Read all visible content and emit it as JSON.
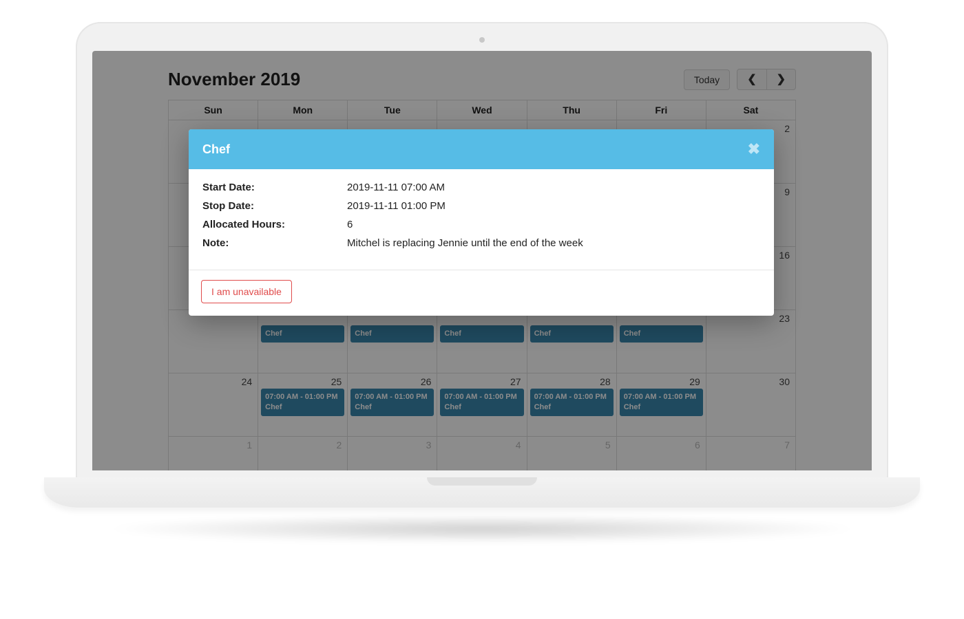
{
  "header": {
    "title": "November 2019",
    "today_label": "Today"
  },
  "days": [
    "Sun",
    "Mon",
    "Tue",
    "Wed",
    "Thu",
    "Fri",
    "Sat"
  ],
  "weeks": [
    [
      {
        "n": "",
        "other": true,
        "event": null
      },
      {
        "n": "",
        "other": true,
        "event": null
      },
      {
        "n": "",
        "other": true,
        "event": null
      },
      {
        "n": "",
        "other": true,
        "event": null
      },
      {
        "n": "",
        "other": true,
        "event": null
      },
      {
        "n": "",
        "other": true,
        "event": null
      },
      {
        "n": "2",
        "other": false,
        "event": null
      }
    ],
    [
      {
        "n": "",
        "other": false,
        "event": null
      },
      {
        "n": "",
        "other": false,
        "event": null
      },
      {
        "n": "",
        "other": false,
        "event": null
      },
      {
        "n": "",
        "other": false,
        "event": null
      },
      {
        "n": "",
        "other": false,
        "event": null
      },
      {
        "n": "",
        "other": false,
        "event": null
      },
      {
        "n": "9",
        "other": false,
        "event": null
      }
    ],
    [
      {
        "n": "",
        "other": false,
        "event": null
      },
      {
        "n": "",
        "other": false,
        "event": null
      },
      {
        "n": "",
        "other": false,
        "event": null
      },
      {
        "n": "",
        "other": false,
        "event": null
      },
      {
        "n": "",
        "other": false,
        "event": null
      },
      {
        "n": "",
        "other": false,
        "event": null
      },
      {
        "n": "16",
        "other": false,
        "event": null
      }
    ],
    [
      {
        "n": "",
        "other": false,
        "event": null
      },
      {
        "n": "",
        "other": false,
        "event": {
          "time": "",
          "role": "Chef"
        }
      },
      {
        "n": "",
        "other": false,
        "event": {
          "time": "",
          "role": "Chef"
        }
      },
      {
        "n": "",
        "other": false,
        "event": {
          "time": "",
          "role": "Chef"
        }
      },
      {
        "n": "",
        "other": false,
        "event": {
          "time": "",
          "role": "Chef"
        }
      },
      {
        "n": "",
        "other": false,
        "event": {
          "time": "",
          "role": "Chef"
        }
      },
      {
        "n": "23",
        "other": false,
        "event": null
      }
    ],
    [
      {
        "n": "24",
        "other": false,
        "event": null
      },
      {
        "n": "25",
        "other": false,
        "event": {
          "time": "07:00 AM - 01:00 PM",
          "role": "Chef"
        }
      },
      {
        "n": "26",
        "other": false,
        "event": {
          "time": "07:00 AM - 01:00 PM",
          "role": "Chef"
        }
      },
      {
        "n": "27",
        "other": false,
        "event": {
          "time": "07:00 AM - 01:00 PM",
          "role": "Chef"
        }
      },
      {
        "n": "28",
        "other": false,
        "event": {
          "time": "07:00 AM - 01:00 PM",
          "role": "Chef"
        }
      },
      {
        "n": "29",
        "other": false,
        "event": {
          "time": "07:00 AM - 01:00 PM",
          "role": "Chef"
        }
      },
      {
        "n": "30",
        "other": false,
        "event": null
      }
    ],
    [
      {
        "n": "1",
        "other": true,
        "event": null
      },
      {
        "n": "2",
        "other": true,
        "event": null
      },
      {
        "n": "3",
        "other": true,
        "event": null
      },
      {
        "n": "4",
        "other": true,
        "event": null
      },
      {
        "n": "5",
        "other": true,
        "event": null
      },
      {
        "n": "6",
        "other": true,
        "event": null
      },
      {
        "n": "7",
        "other": true,
        "event": null
      }
    ]
  ],
  "modal": {
    "title": "Chef",
    "rows": {
      "start_label": "Start Date:",
      "start_value": "2019-11-11 07:00 AM",
      "stop_label": "Stop Date:",
      "stop_value": "2019-11-11 01:00 PM",
      "hours_label": "Allocated Hours:",
      "hours_value": "6",
      "note_label": "Note:",
      "note_value": "Mitchel is replacing Jennie until the end of the week"
    },
    "unavailable_label": "I am unavailable"
  }
}
